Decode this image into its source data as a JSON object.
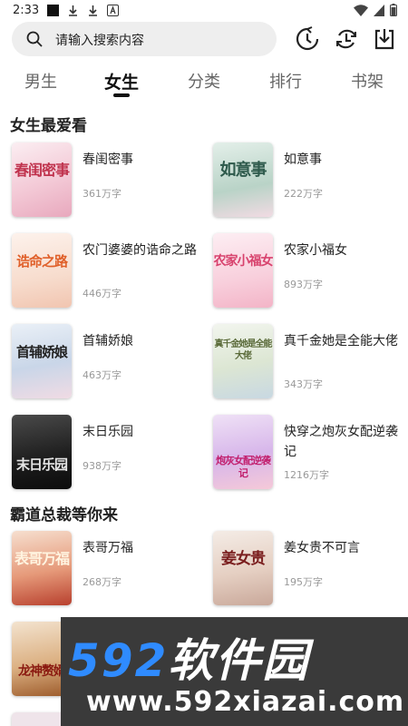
{
  "status": {
    "time": "2:33"
  },
  "search": {
    "placeholder": "请输入搜索内容"
  },
  "tabs": [
    {
      "label": "男生"
    },
    {
      "label": "女生"
    },
    {
      "label": "分类"
    },
    {
      "label": "排行"
    },
    {
      "label": "书架"
    }
  ],
  "sections": [
    {
      "title": "女生最爱看",
      "books": [
        {
          "title": "春闺密事",
          "words": "361万字",
          "cover_text": "春闺密事"
        },
        {
          "title": "如意事",
          "words": "222万字",
          "cover_text": "如意事"
        },
        {
          "title": "农门婆婆的诰命之路",
          "words": "446万字",
          "cover_text": "诰命之路"
        },
        {
          "title": "农家小福女",
          "words": "893万字",
          "cover_text": "农家小福女"
        },
        {
          "title": "首辅娇娘",
          "words": "463万字",
          "cover_text": "首辅娇娘"
        },
        {
          "title": "真千金她是全能大佬",
          "words": "343万字",
          "cover_text": "真千金她是全能大佬"
        },
        {
          "title": "末日乐园",
          "words": "938万字",
          "cover_text": "末日乐园"
        },
        {
          "title": "快穿之炮灰女配逆袭记",
          "words": "1216万字",
          "cover_text": "炮灰女配逆袭记"
        }
      ]
    },
    {
      "title": "霸道总裁等你来",
      "books": [
        {
          "title": "表哥万福",
          "words": "268万字",
          "cover_text": "表哥万福"
        },
        {
          "title": "姜女贵不可言",
          "words": "195万字",
          "cover_text": "姜女贵"
        },
        {
          "title": "",
          "words": "",
          "cover_text": "龙神赘婿"
        }
      ]
    }
  ],
  "watermark": {
    "brand_num": "592",
    "brand_cn": "软件园",
    "url": "www.592xiazai.com"
  },
  "colors": {
    "accent": "#2f8bff",
    "tab_active": "#111111",
    "muted": "#999999"
  }
}
